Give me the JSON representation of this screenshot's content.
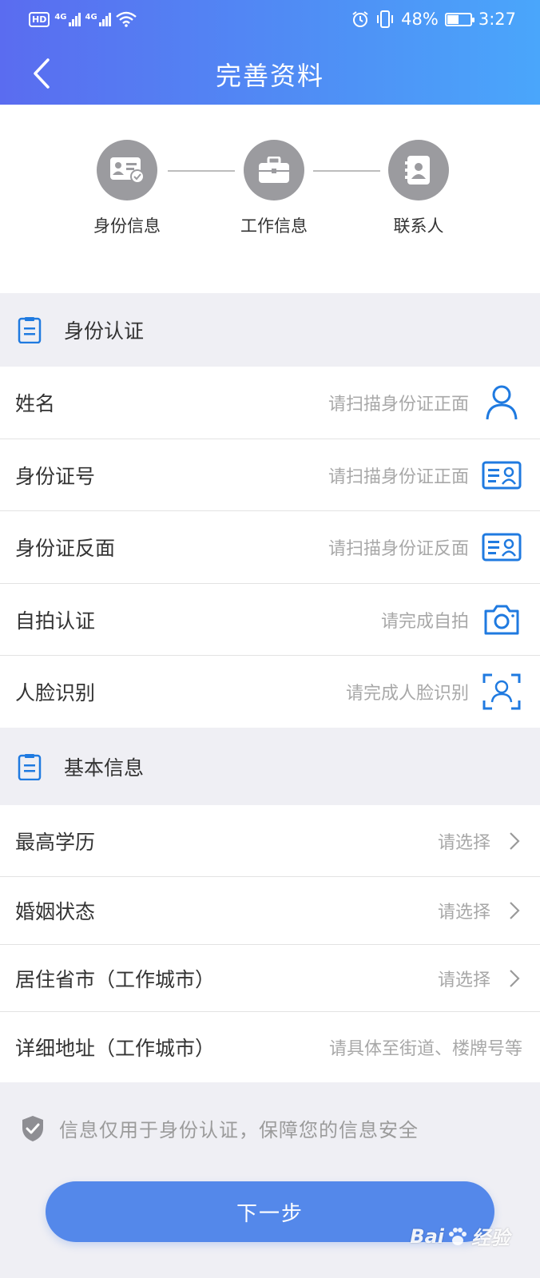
{
  "status_bar": {
    "hd": "HD",
    "network1": "4G",
    "network2": "4G",
    "battery": "48%",
    "time": "3:27",
    "icons": [
      "alarm-icon",
      "vibrate-icon",
      "wifi-icon",
      "battery-icon"
    ]
  },
  "nav": {
    "title": "完善资料",
    "back_icon": "chevron-left-icon"
  },
  "steps": [
    {
      "label": "身份信息",
      "icon": "id-card-check-icon"
    },
    {
      "label": "工作信息",
      "icon": "briefcase-icon"
    },
    {
      "label": "联系人",
      "icon": "contact-book-icon"
    }
  ],
  "identity_section": {
    "title": "身份认证",
    "rows": [
      {
        "label": "姓名",
        "hint": "请扫描身份证正面",
        "icon": "person-icon"
      },
      {
        "label": "身份证号",
        "hint": "请扫描身份证正面",
        "icon": "id-card-icon"
      },
      {
        "label": "身份证反面",
        "hint": "请扫描身份证反面",
        "icon": "id-card-icon"
      },
      {
        "label": "自拍认证",
        "hint": "请完成自拍",
        "icon": "camera-icon"
      },
      {
        "label": "人脸识别",
        "hint": "请完成人脸识别",
        "icon": "face-scan-icon"
      }
    ]
  },
  "basic_section": {
    "title": "基本信息",
    "rows": [
      {
        "label": "最高学历",
        "hint": "请选择"
      },
      {
        "label": "婚姻状态",
        "hint": "请选择"
      },
      {
        "label": "居住省市（工作城市）",
        "hint": "请选择"
      },
      {
        "label": "详细地址（工作城市）",
        "hint": "请具体至街道、楼牌号等"
      }
    ]
  },
  "notice": {
    "text": "信息仅用于身份认证，保障您的信息安全"
  },
  "next_button": {
    "label": "下一步"
  },
  "watermark": {
    "text": "Bai",
    "text2": "经验"
  },
  "colors": {
    "accent": "#1f7ae0",
    "button": "#5488ea",
    "step_gray": "#9b9b9f",
    "header_start": "#5a6cf0",
    "header_end": "#4aa6fb"
  }
}
